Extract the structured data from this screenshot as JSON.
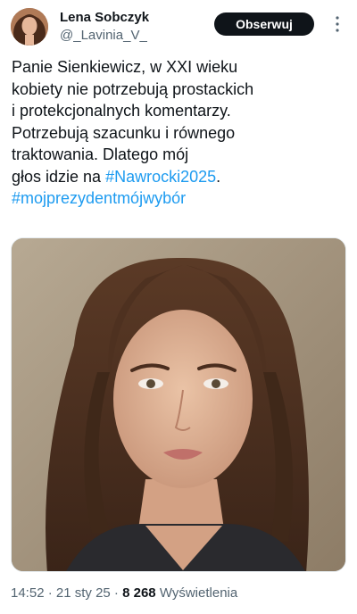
{
  "tweet": {
    "author": {
      "display_name": "Lena Sobczyk",
      "handle": "@_Lavinia_V_"
    },
    "follow_label": "Obserwuj",
    "text_lines": [
      [
        {
          "t": "Panie Sienkiewicz, w XXI wieku",
          "tag": false
        }
      ],
      [
        {
          "t": "kobiety nie potrzebują prostackich",
          "tag": false
        }
      ],
      [
        {
          "t": "i protekcjonalnych komentarzy.",
          "tag": false
        }
      ],
      [
        {
          "t": "Potrzebują szacunku i równego",
          "tag": false
        }
      ],
      [
        {
          "t": "traktowania. Dlatego mój",
          "tag": false
        }
      ],
      [
        {
          "t": "głos idzie na ",
          "tag": false
        },
        {
          "t": "#Nawrocki2025",
          "tag": true
        },
        {
          "t": ".",
          "tag": false
        }
      ],
      [
        {
          "t": "#mojprezydentmójwybór",
          "tag": true
        }
      ]
    ],
    "meta": {
      "time": "14:52",
      "sep1": " · ",
      "date": "21 sty 25",
      "sep2": " · ",
      "views_count": "8 268",
      "views_label": " Wyświetlenia"
    }
  },
  "icons": {
    "more": "more-vertical-icon"
  },
  "colors": {
    "text": "#0f1419",
    "secondary": "#536471",
    "link": "#1d9bf0",
    "button_bg": "#0f1419",
    "button_text": "#ffffff"
  }
}
